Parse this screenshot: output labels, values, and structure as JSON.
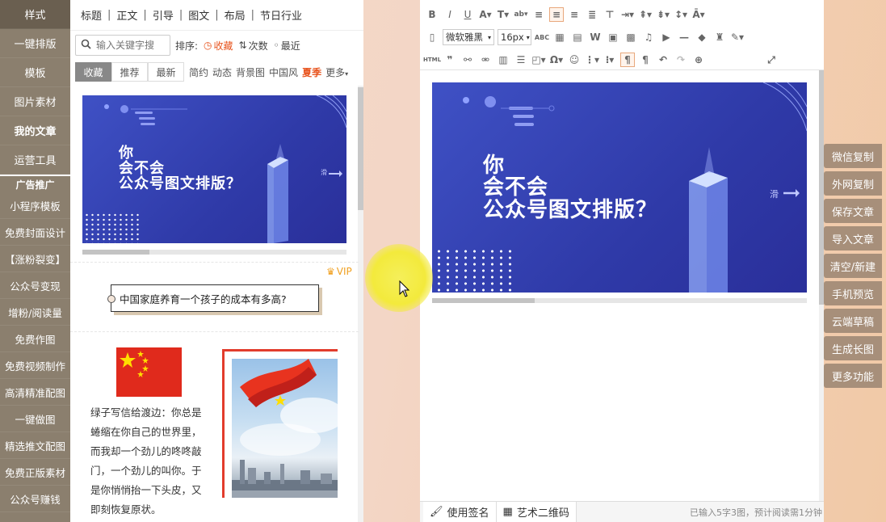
{
  "sidebar": {
    "items": [
      {
        "label": "样式",
        "active": true
      },
      {
        "label": "一键排版"
      },
      {
        "label": "模板"
      },
      {
        "label": "图片素材"
      },
      {
        "label": "我的文章"
      },
      {
        "label": "运营工具"
      }
    ],
    "divider": "广告推广",
    "ads": [
      "小程序模板",
      "免费封面设计",
      "【涨粉裂变】",
      "公众号变现",
      "增粉/阅读量",
      "免费作图",
      "免费视频制作",
      "高清精准配图",
      "一键做图",
      "精选推文配图",
      "免费正版素材",
      "公众号赚钱"
    ]
  },
  "panel": {
    "tabs": [
      "标题",
      "正文",
      "引导",
      "图文",
      "布局",
      "节日行业"
    ],
    "search_placeholder": "输入关键字搜",
    "sort_label": "排序:",
    "sort_options": [
      "收藏",
      "次数",
      "最近"
    ],
    "filter_buttons": [
      "收藏",
      "推荐",
      "最新"
    ],
    "filter_links": [
      "简约",
      "动态",
      "背景图",
      "中国风"
    ],
    "filter_hot": "夏季",
    "filter_more": "更多",
    "banner_text": [
      "你",
      "会不会",
      "公众号图文排版？"
    ],
    "slide_label": "滑",
    "vip_label": "VIP",
    "question": "中国家庭养育一个孩子的成本有多高?",
    "story": "绿子写信给渡边：你总是蜷缩在你自己的世界里，而我却一个劲儿的咚咚敲门，一个劲儿的叫你。于是你悄悄抬一下头皮，又即刻恢复原状。"
  },
  "editor": {
    "font_family": "微软雅黑",
    "font_size": "16px",
    "banner_text": [
      "你",
      "会不会",
      "公众号图文排版？"
    ],
    "slide_label": "滑",
    "status_buttons": [
      "使用签名",
      "艺术二维码"
    ],
    "word_count": "已输入5字3图，预计阅读需1分钟"
  },
  "right_buttons": [
    "微信复制",
    "外网复制",
    "保存文章",
    "导入文章",
    "清空/新建",
    "手机预览",
    "云端草稿",
    "生成长图",
    "更多功能"
  ],
  "colors": {
    "sidebar": "#8b7f6e",
    "accent": "#e8541e",
    "banner": "#3441b0",
    "right_button": "#a78f7a"
  }
}
